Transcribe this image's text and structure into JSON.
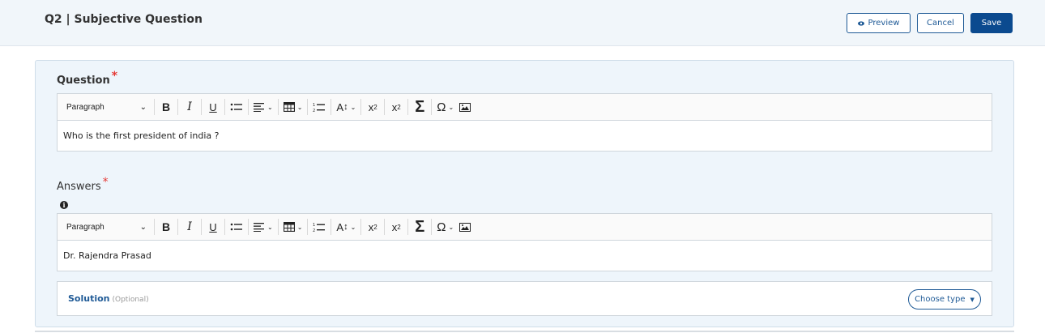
{
  "header": {
    "title": "Q2 | Subjective Question",
    "preview_label": "Preview",
    "cancel_label": "Cancel",
    "save_label": "Save"
  },
  "question": {
    "label": "Question",
    "required_mark": "*",
    "toolbar": {
      "format_select": "Paragraph"
    },
    "content": "Who is the first president of india ?"
  },
  "answers": {
    "label": "Answers",
    "required_mark": "*",
    "info_glyph": "i",
    "toolbar": {
      "format_select": "Paragraph"
    },
    "content": "Dr. Rajendra Prasad"
  },
  "solution": {
    "label": "Solution",
    "optional_label": "(Optional)",
    "choose_label": "Choose type"
  },
  "colors": {
    "primary": "#0b4a8f",
    "accent_text": "#1f5a96",
    "required": "#e53935",
    "card_bg": "#eef5fb",
    "header_bg": "#f1f6fa"
  }
}
